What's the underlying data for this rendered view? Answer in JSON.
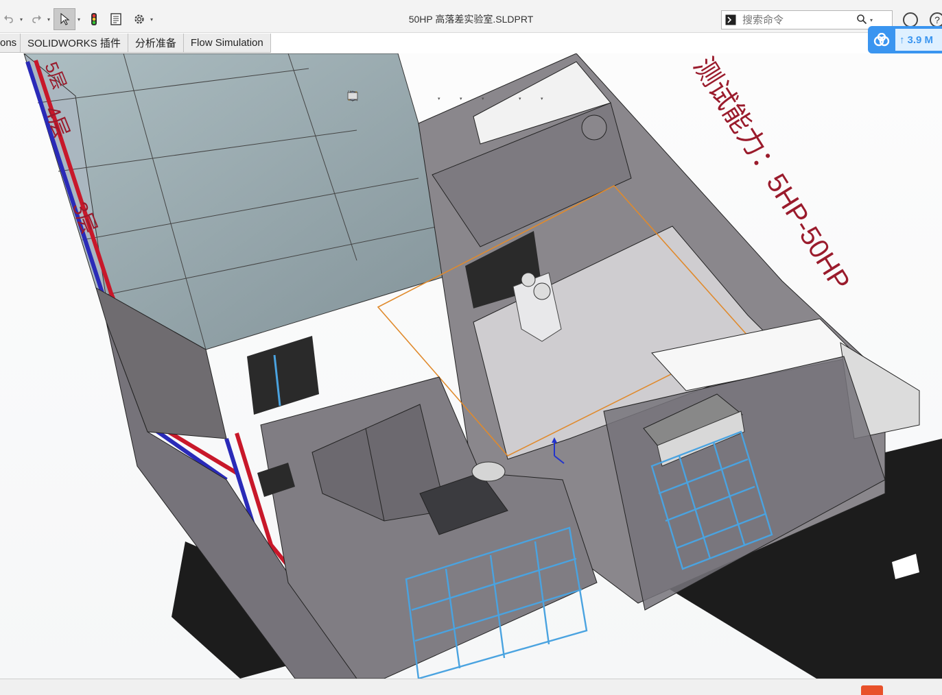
{
  "window": {
    "doc_title": "50HP 高落差实验室.SLDPRT"
  },
  "toolbar": {
    "undo_icon": "undo-icon",
    "redo_icon": "redo-icon",
    "select_icon": "cursor-select-icon",
    "rebuild_icon": "traffic-light-icon",
    "file_props_icon": "file-properties-icon",
    "options_icon": "gear-icon"
  },
  "search": {
    "placeholder": "搜索命令"
  },
  "tabs": [
    {
      "label": "ons"
    },
    {
      "label": "SOLIDWORKS 插件"
    },
    {
      "label": "分析准备"
    },
    {
      "label": "Flow Simulation"
    }
  ],
  "cloud_widget": {
    "speed_label": "3.9 M",
    "accent": "#3a95f0"
  },
  "model": {
    "annotation_text": "测试能力：5HP-50HP",
    "floor_labels": [
      "5层",
      "4层",
      "3层"
    ],
    "outline_color": "#e08a2c",
    "rack_color": "#4aa3e0",
    "pipe_red": "#c8182a",
    "pipe_blue": "#2a2ab8"
  }
}
